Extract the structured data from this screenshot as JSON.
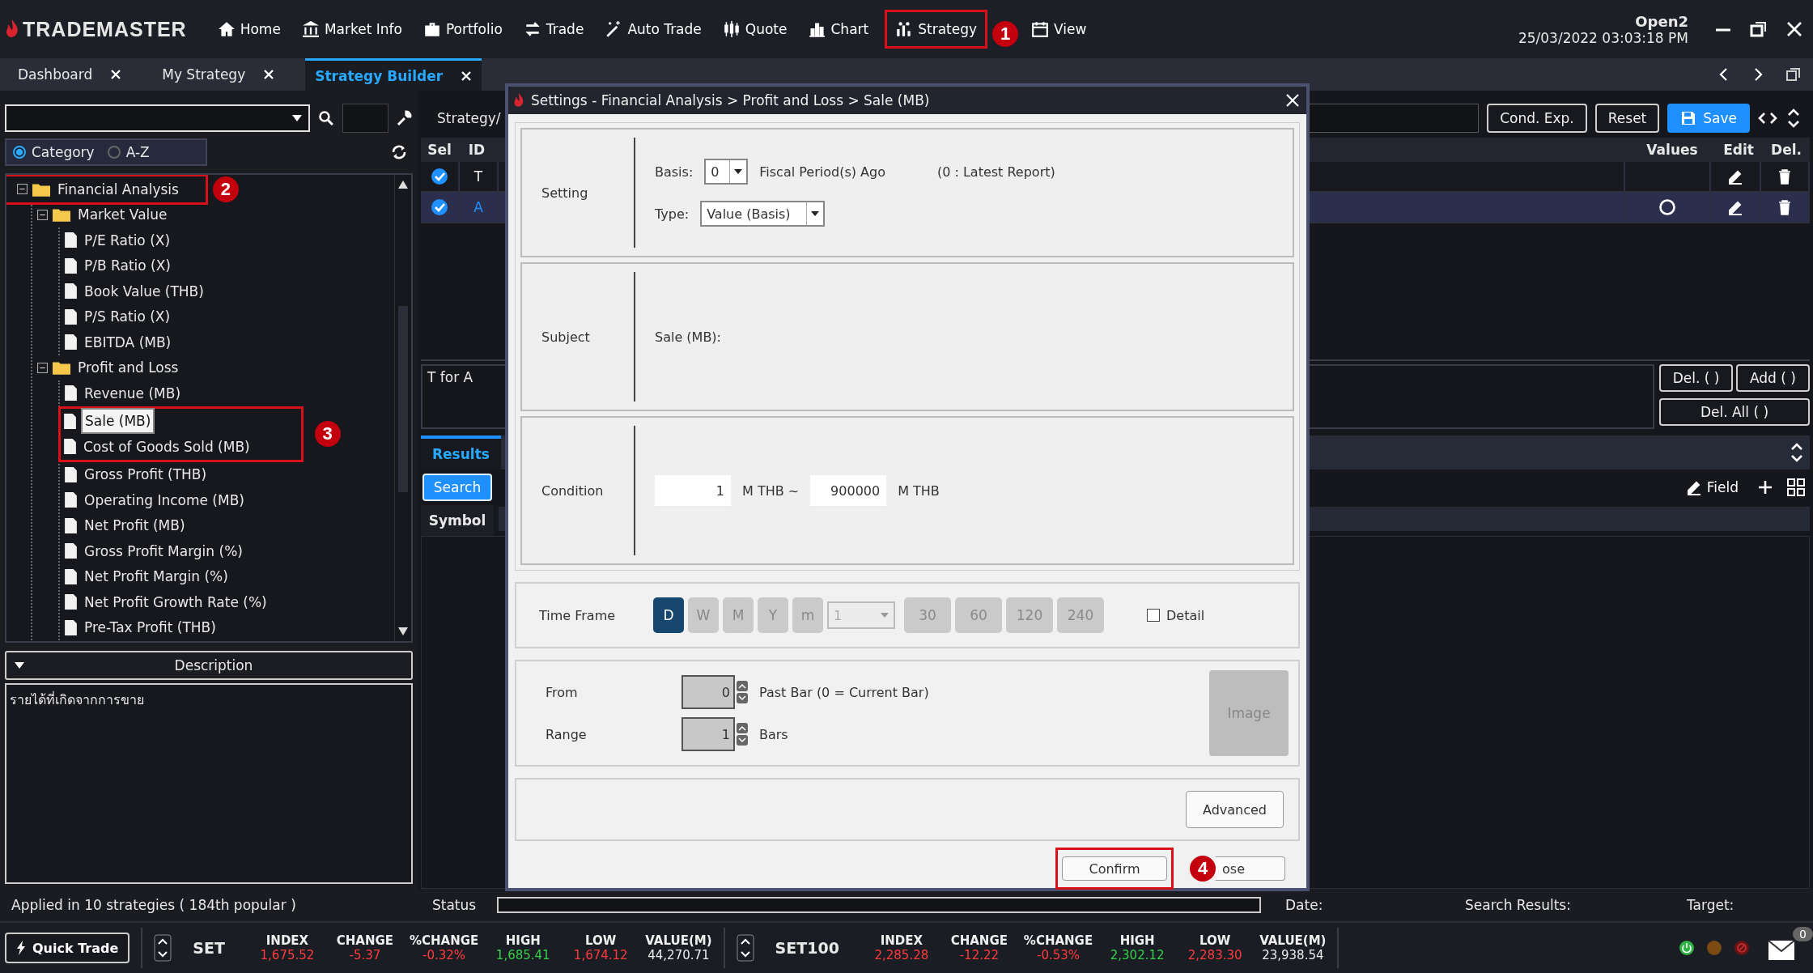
{
  "app": {
    "logo": "TRADEMASTER",
    "user": "Open2",
    "datetime": "25/03/2022 03:03:18 PM",
    "nav": [
      {
        "label": "Home"
      },
      {
        "label": "Market Info"
      },
      {
        "label": "Portfolio"
      },
      {
        "label": "Trade"
      },
      {
        "label": "Auto Trade"
      },
      {
        "label": "Quote"
      },
      {
        "label": "Chart"
      },
      {
        "label": "Strategy",
        "callout": "1"
      },
      {
        "label": "View"
      }
    ]
  },
  "tabs": [
    {
      "label": "Dashboard",
      "selected": false
    },
    {
      "label": "My Strategy",
      "selected": false
    },
    {
      "label": "Strategy Builder",
      "selected": true
    }
  ],
  "left_panel": {
    "sort_options": [
      {
        "label": "Category",
        "selected": true
      },
      {
        "label": "A-Z",
        "selected": false
      }
    ],
    "tree": [
      {
        "label": "Financial Analysis",
        "expanded": true,
        "callout": "2",
        "children": [
          {
            "label": "Market Value",
            "expanded": true,
            "children": [
              {
                "label": "P/E Ratio (X)",
                "selected": false,
                "marked": false
              },
              {
                "label": "P/B Ratio (X)",
                "selected": false,
                "marked": false
              },
              {
                "label": "Book Value (THB)",
                "selected": false,
                "marked": false
              },
              {
                "label": "P/S Ratio (X)",
                "selected": false,
                "marked": false
              },
              {
                "label": "EBITDA (MB)",
                "selected": false,
                "marked": false
              }
            ]
          },
          {
            "label": "Profit and Loss",
            "expanded": true,
            "children": [
              {
                "label": "Revenue (MB)",
                "selected": false,
                "marked": false
              },
              {
                "label": "Sale (MB)",
                "selected": true,
                "marked": true,
                "callout": "3"
              },
              {
                "label": "Cost of Goods Sold (MB)",
                "selected": false,
                "marked": true
              },
              {
                "label": "Gross Profit (THB)",
                "selected": false,
                "marked": false
              },
              {
                "label": "Operating Income (MB)",
                "selected": false,
                "marked": false
              },
              {
                "label": "Net Profit (MB)",
                "selected": false,
                "marked": false
              },
              {
                "label": "Gross Profit Margin (%)",
                "selected": false,
                "marked": false
              },
              {
                "label": "Net Profit Margin (%)",
                "selected": false,
                "marked": false
              },
              {
                "label": "Net Profit Growth Rate (%)",
                "selected": false,
                "marked": false
              },
              {
                "label": "Pre-Tax Profit (THB)",
                "selected": false,
                "marked": false
              }
            ]
          }
        ]
      }
    ],
    "description_header": "Description",
    "description": "รายได้ที่เกิดจากการขาย",
    "footer": "Applied in 10 strategies ( 184th popular )"
  },
  "strategy": {
    "path_label": "Strategy/",
    "buttons": [
      {
        "label": "Cond. Exp.",
        "kind": "plain"
      },
      {
        "label": "Reset",
        "kind": "plain"
      },
      {
        "label": "Save",
        "kind": "primary"
      }
    ],
    "columns": [
      "Sel",
      "ID",
      "Values",
      "Edit",
      "Del."
    ],
    "rows": [
      {
        "checked": true,
        "id": "T",
        "selected": false,
        "value_marker": false
      },
      {
        "checked": true,
        "id": "A",
        "selected": true,
        "value_marker": true
      }
    ],
    "expression": "T for A",
    "expression_buttons": [
      "Del. ( )",
      "Add ( )",
      "Del. All ( )"
    ]
  },
  "results": {
    "tab": "Results",
    "search_button": "Search",
    "field_button": "Field",
    "columns": [
      "Symbol"
    ]
  },
  "status_bar": {
    "status_label": "Status",
    "date_label": "Date:",
    "search_results_label": "Search Results:",
    "target_label": "Target:"
  },
  "ticker": {
    "quick_trade": "Quick Trade",
    "mail_count": "0",
    "markets": [
      {
        "name": "SET",
        "columns": [
          {
            "label": "INDEX",
            "value": "1,675.52",
            "color": "#ff3b3b"
          },
          {
            "label": "CHANGE",
            "value": "-5.37",
            "color": "#ff3b3b"
          },
          {
            "label": "%CHANGE",
            "value": "-0.32%",
            "color": "#ff3b3b"
          },
          {
            "label": "HIGH",
            "value": "1,685.41",
            "color": "#35d04a"
          },
          {
            "label": "LOW",
            "value": "1,674.12",
            "color": "#ff3b3b"
          },
          {
            "label": "VALUE(M)",
            "value": "44,270.71",
            "color": "#ececec"
          }
        ]
      },
      {
        "name": "SET100",
        "columns": [
          {
            "label": "INDEX",
            "value": "2,285.28",
            "color": "#ff3b3b"
          },
          {
            "label": "CHANGE",
            "value": "-12.22",
            "color": "#ff3b3b"
          },
          {
            "label": "%CHANGE",
            "value": "-0.53%",
            "color": "#ff3b3b"
          },
          {
            "label": "HIGH",
            "value": "2,302.12",
            "color": "#35d04a"
          },
          {
            "label": "LOW",
            "value": "2,283.30",
            "color": "#ff3b3b"
          },
          {
            "label": "VALUE(M)",
            "value": "23,938.54",
            "color": "#ececec"
          }
        ]
      }
    ]
  },
  "dialog": {
    "title": "Settings - Financial Analysis > Profit and Loss > Sale (MB)",
    "setting": {
      "label": "Setting",
      "basis_label": "Basis:",
      "basis_value": "0",
      "basis_suffix": "Fiscal Period(s) Ago",
      "basis_note": "(0 : Latest Report)",
      "type_label": "Type:",
      "type_value": "Value (Basis)"
    },
    "subject": {
      "label": "Subject",
      "text": "Sale (MB):"
    },
    "condition": {
      "label": "Condition",
      "from": "1",
      "from_unit": "M THB ~",
      "to": "900000",
      "to_unit": "M THB"
    },
    "timeframe": {
      "label": "Time Frame",
      "periods": [
        {
          "label": "D",
          "selected": true
        },
        {
          "label": "W",
          "selected": false
        },
        {
          "label": "M",
          "selected": false
        },
        {
          "label": "Y",
          "selected": false
        },
        {
          "label": "m",
          "selected": false
        }
      ],
      "interval": "1",
      "minutes": [
        "30",
        "60",
        "120",
        "240"
      ],
      "detail": {
        "label": "Detail",
        "checked": false
      }
    },
    "bars": {
      "from_label": "From",
      "from_value": "0",
      "from_note": "Past Bar (0 = Current Bar)",
      "range_label": "Range",
      "range_value": "1",
      "range_note": "Bars",
      "image_button": "Image"
    },
    "advanced_button": "Advanced",
    "confirm_button": "Confirm",
    "confirm_callout": "4",
    "close_button": "ose"
  }
}
